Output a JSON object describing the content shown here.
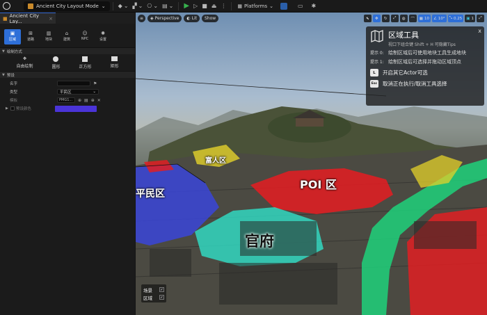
{
  "toolbar": {
    "level_name": "Ancient City Layout Mode",
    "platforms_label": "Platforms"
  },
  "left_panel": {
    "tab_title": "Ancient City Lay...",
    "modes": [
      {
        "label": "区域",
        "icon": "region-icon"
      },
      {
        "label": "道路",
        "icon": "road-icon"
      },
      {
        "label": "地块",
        "icon": "plot-icon"
      },
      {
        "label": "建筑",
        "icon": "building-icon"
      },
      {
        "label": "NPC",
        "icon": "npc-icon"
      },
      {
        "label": "设置",
        "icon": "settings-icon"
      }
    ],
    "draw_section": "绘制方式",
    "draw_tools": [
      {
        "label": "自由绘制",
        "icon": "freehand-icon"
      },
      {
        "label": "圆形",
        "icon": "circle-icon"
      },
      {
        "label": "正方形",
        "icon": "square-icon"
      },
      {
        "label": "矩形",
        "icon": "rectangle-icon"
      }
    ],
    "preset_section": "预设",
    "name_label": "名字",
    "type_label": "类型",
    "type_value": "平民区",
    "template_label": "模板",
    "template_value": "PMG1...",
    "color_label": "预设颜色",
    "color_value": "#4a34d8"
  },
  "viewport": {
    "perspective": "Perspective",
    "lit": "Lit",
    "show": "Show",
    "grid_value": "10",
    "angle_value": "10°",
    "scale_value": "0.25",
    "camera_value": "1"
  },
  "zones": {
    "rich": "富人区",
    "civilian": "平民区",
    "poi": "POI 区",
    "official": "官府"
  },
  "help": {
    "title": "区域工具",
    "subtitle": "视口下组合键 Shift + H 可隐藏Tips",
    "tip0_key": "提示 0:",
    "tip0_text": "绘制区域后可使用地块工具生成地块",
    "tip1_key": "提示 1:",
    "tip1_text": "绘制区域后可选择并拖动区域顶点",
    "key_l": "L",
    "key_l_text": "开启其它Actor可选",
    "key_esc": "Esc",
    "key_esc_text": "取消正在执行/取消工具选择",
    "close": "x"
  },
  "layers": {
    "scene": "场景",
    "region": "区域"
  },
  "colors": {
    "civilian": "#3a45d8",
    "poi": "#e01e22",
    "official": "#2fe0c8",
    "road": "#1fd17a",
    "rich": "#e3d22a",
    "accent": "#2e6fd8"
  }
}
